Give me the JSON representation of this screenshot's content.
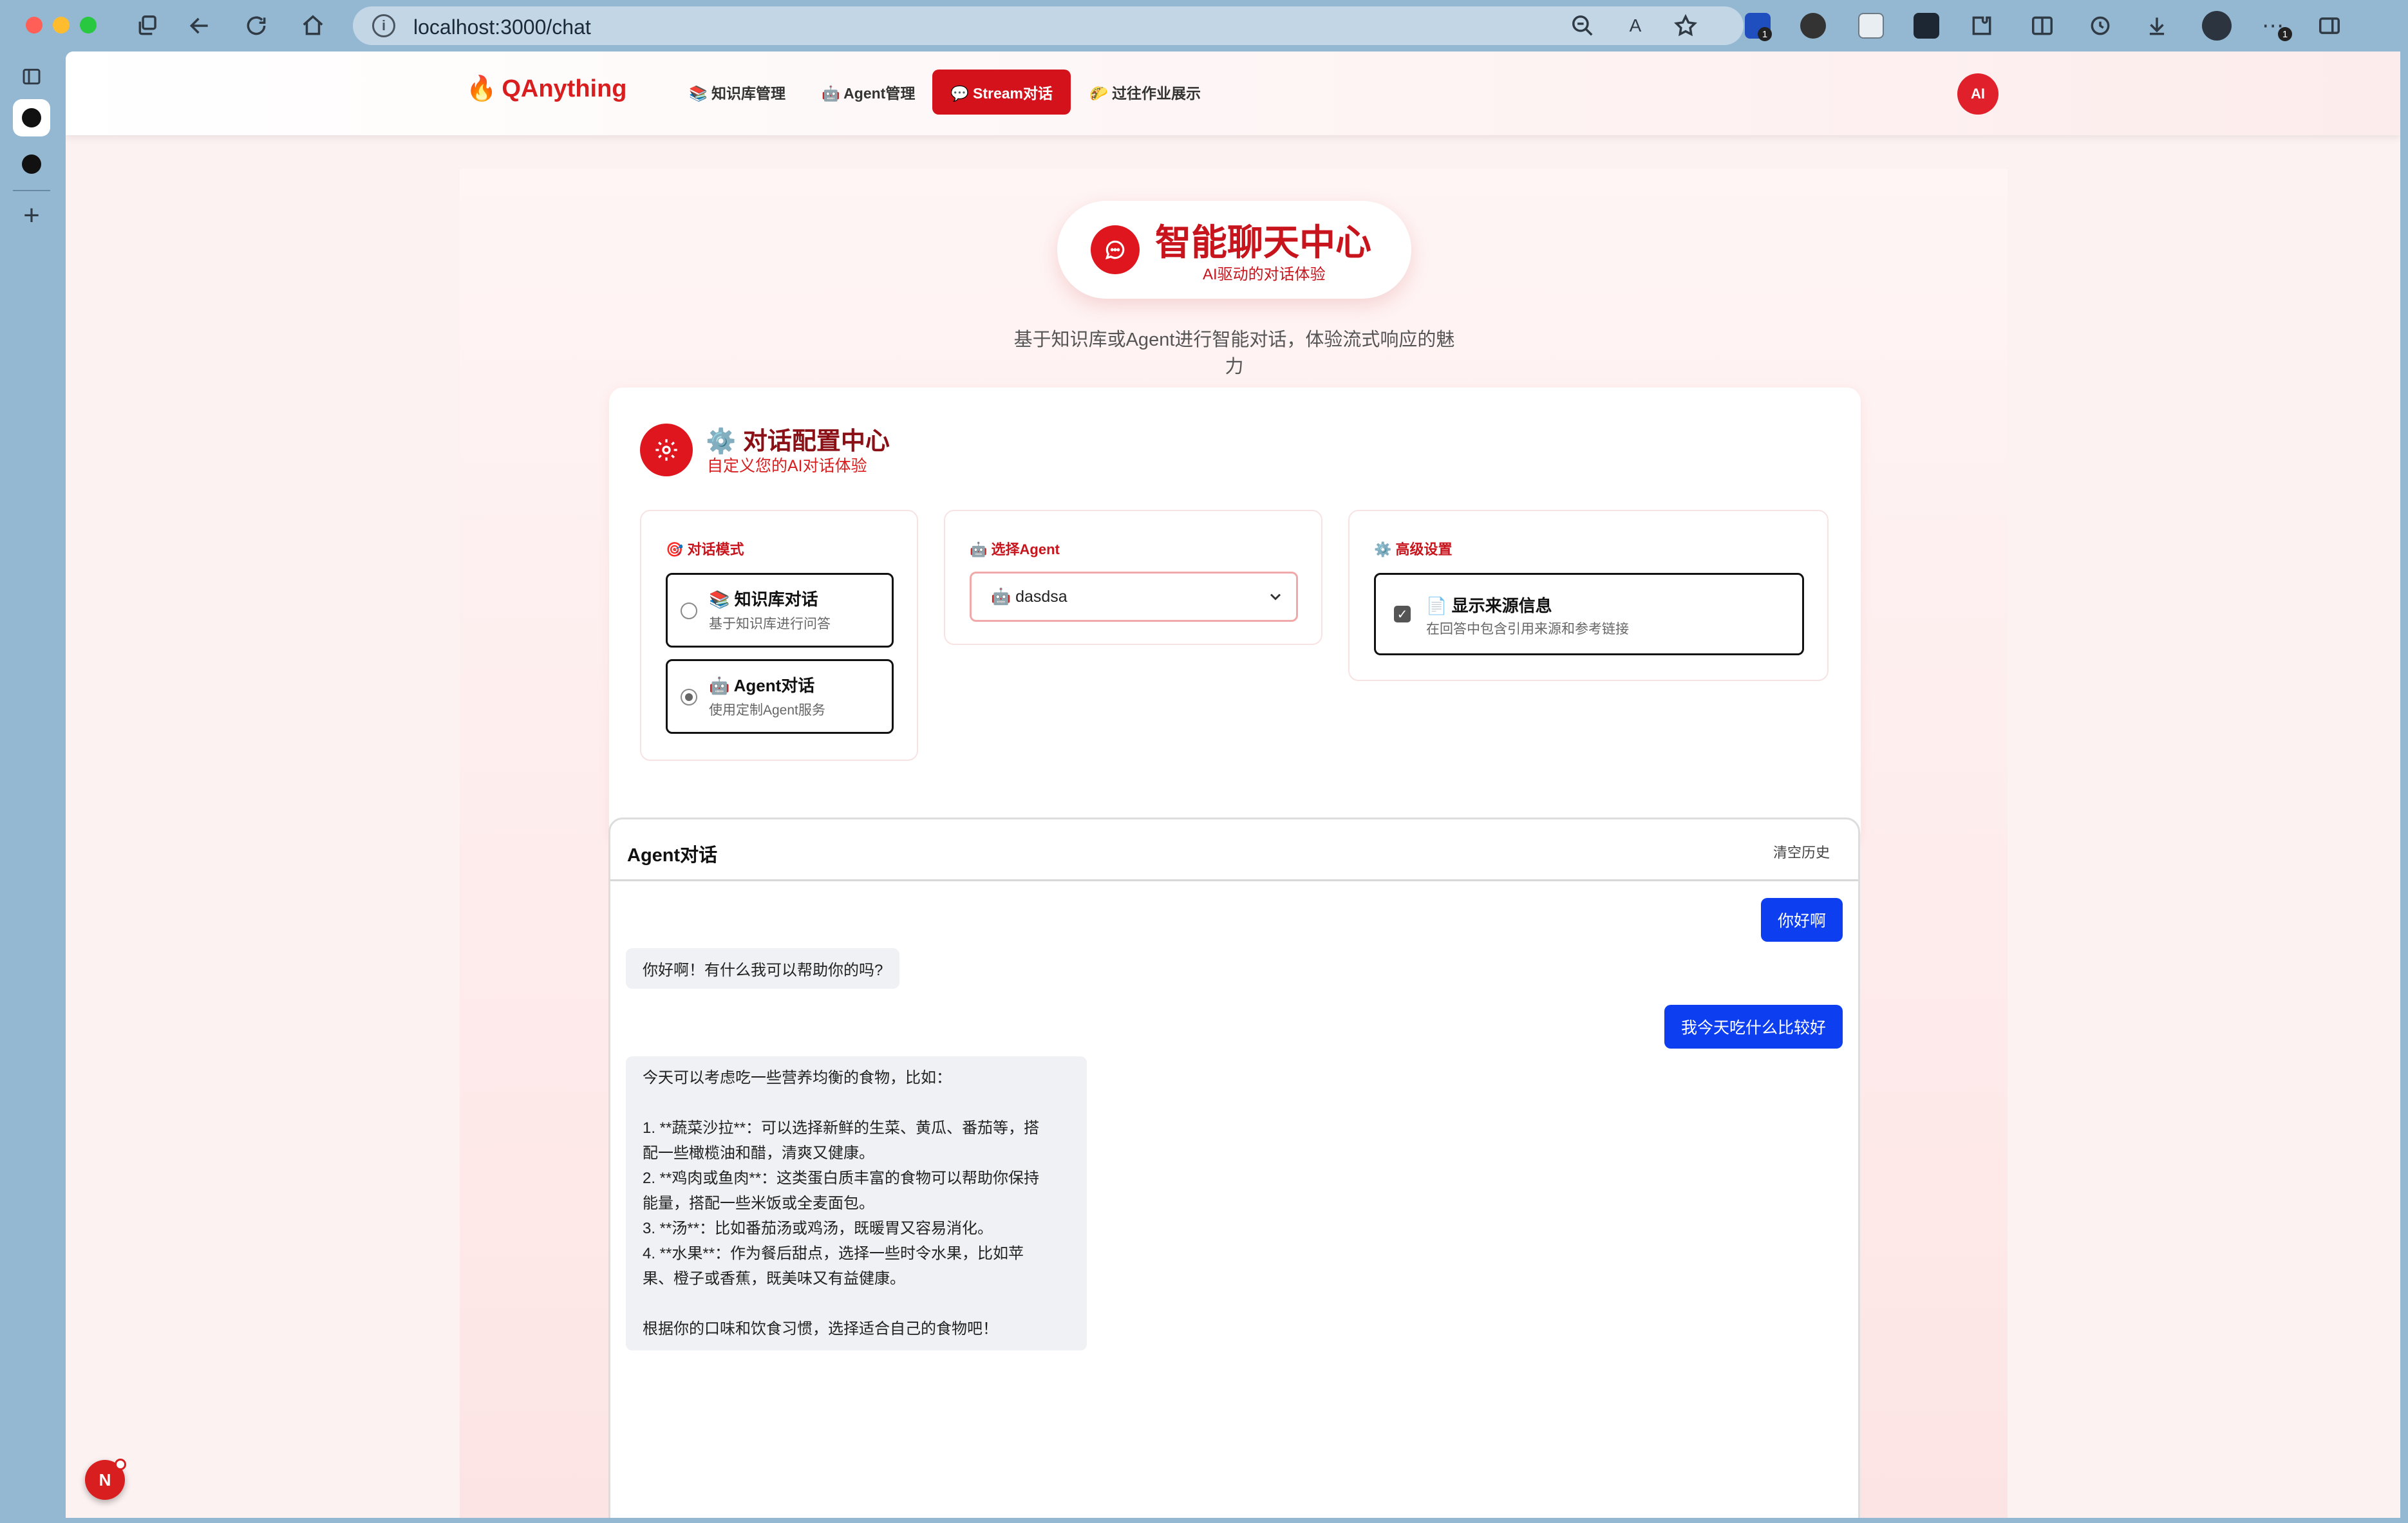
{
  "browser": {
    "url": "localhost:3000/chat",
    "extension_badge": "1",
    "more_badge": "1"
  },
  "nav": {
    "logo": "QAnything",
    "logo_emoji": "🔥",
    "items": [
      {
        "label": "📚 知识库管理"
      },
      {
        "label": "🤖 Agent管理"
      },
      {
        "label": "💬 Stream对话"
      },
      {
        "label": "🌮 过往作业展示"
      }
    ],
    "avatar": "AI"
  },
  "hero": {
    "title": "智能聊天中心",
    "subtitle": "AI驱动的对话体验",
    "description": "基于知识库或Agent进行智能对话，体验流式响应的魅力"
  },
  "config": {
    "title": "⚙️ 对话配置中心",
    "subtitle": "自定义您的AI对话体验",
    "mode": {
      "label": "🎯 对话模式",
      "options": [
        {
          "title": "📚 知识库对话",
          "desc": "基于知识库进行问答",
          "checked": false
        },
        {
          "title": "🤖 Agent对话",
          "desc": "使用定制Agent服务",
          "checked": true
        }
      ]
    },
    "agent": {
      "label": "🤖 选择Agent",
      "selected": "🤖 dasdsa"
    },
    "advanced": {
      "label": "⚙️ 高级设置",
      "option_title": "📄 显示来源信息",
      "option_desc": "在回答中包含引用来源和参考链接",
      "checked": true
    }
  },
  "chat": {
    "title": "Agent对话",
    "clear_label": "清空历史",
    "messages": [
      {
        "role": "user",
        "text": "你好啊"
      },
      {
        "role": "assistant",
        "text": "你好啊！有什么我可以帮助你的吗?"
      },
      {
        "role": "user",
        "text": "我今天吃什么比较好"
      },
      {
        "role": "assistant",
        "lines": [
          "今天可以考虑吃一些营养均衡的食物，比如：",
          "",
          "1. **蔬菜沙拉**：可以选择新鲜的生菜、黄瓜、番茄等，搭",
          "配一些橄榄油和醋，清爽又健康。",
          "2. **鸡肉或鱼肉**：这类蛋白质丰富的食物可以帮助你保持",
          "能量，搭配一些米饭或全麦面包。",
          "3. **汤**：比如番茄汤或鸡汤，既暖胃又容易消化。",
          "4. **水果**：作为餐后甜点，选择一些时令水果，比如苹",
          "果、橙子或香蕉，既美味又有益健康。",
          "",
          "根据你的口味和饮食习惯，选择适合自己的食物吧！"
        ]
      }
    ]
  },
  "float_button": "N",
  "colors": {
    "brand": "#d3121b",
    "user_bubble": "#0d3ff0"
  }
}
